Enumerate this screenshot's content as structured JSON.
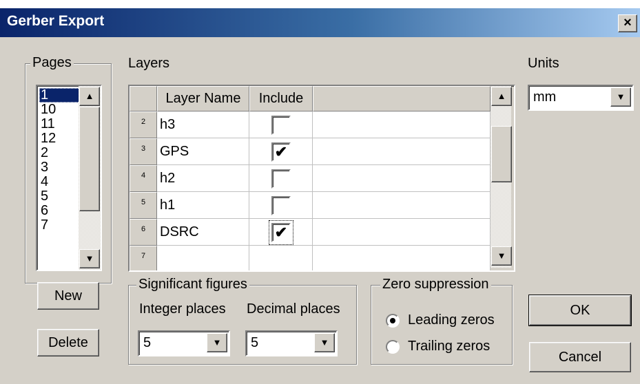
{
  "window": {
    "title": "Gerber Export",
    "close_glyph": "×"
  },
  "pages": {
    "legend": "Pages",
    "items": [
      "1",
      "10",
      "11",
      "12",
      "2",
      "3",
      "4",
      "5",
      "6",
      "7"
    ],
    "selected": "1",
    "new_label": "New",
    "delete_label": "Delete"
  },
  "layers": {
    "label": "Layers",
    "columns": [
      "Layer Name",
      "Include"
    ],
    "rows": [
      {
        "num": "2",
        "name": "h3",
        "include": false
      },
      {
        "num": "3",
        "name": "GPS",
        "include": true
      },
      {
        "num": "4",
        "name": "h2",
        "include": false
      },
      {
        "num": "5",
        "name": "h1",
        "include": false
      },
      {
        "num": "6",
        "name": "DSRC",
        "include": true
      },
      {
        "num": "7",
        "name": "",
        "include": null
      }
    ],
    "check_glyph": "✔"
  },
  "units": {
    "label": "Units",
    "value": "mm"
  },
  "significant_figures": {
    "legend": "Significant figures",
    "integer_label": "Integer places",
    "integer_value": "5",
    "decimal_label": "Decimal places",
    "decimal_value": "5"
  },
  "zero_suppression": {
    "legend": "Zero suppression",
    "options": [
      "Leading zeros",
      "Trailing zeros"
    ],
    "selected": "Leading zeros"
  },
  "buttons": {
    "ok": "OK",
    "cancel": "Cancel"
  },
  "icons": {
    "scroll_up": "▲",
    "scroll_down": "▼",
    "dropdown": "▼"
  }
}
